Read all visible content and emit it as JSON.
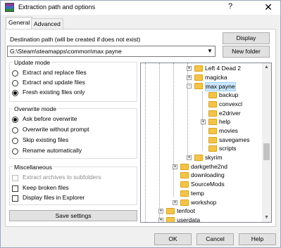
{
  "window": {
    "title": "Extraction path and options",
    "help_glyph": "?",
    "close_glyph": "✕"
  },
  "tabs": [
    "General",
    "Advanced"
  ],
  "destination": {
    "label": "Destination path (will be created if does not exist)",
    "value": "G:\\Steam\\steamapps\\common\\max payne",
    "display_button": "Display",
    "new_folder_button": "New folder"
  },
  "update_mode": {
    "title": "Update mode",
    "options": [
      {
        "label": "Extract and replace files",
        "checked": false
      },
      {
        "label": "Extract and update files",
        "checked": false
      },
      {
        "label": "Fresh existing files only",
        "checked": true
      }
    ]
  },
  "overwrite_mode": {
    "title": "Overwrite mode",
    "options": [
      {
        "label": "Ask before overwrite",
        "checked": true
      },
      {
        "label": "Overwrite without prompt",
        "checked": false
      },
      {
        "label": "Skip existing files",
        "checked": false
      },
      {
        "label": "Rename automatically",
        "checked": false
      }
    ]
  },
  "miscellaneous": {
    "title": "Miscellaneous",
    "options": [
      {
        "label": "Extract archives to subfolders",
        "checked": false,
        "disabled": true
      },
      {
        "label": "Keep broken files",
        "checked": false,
        "disabled": false
      },
      {
        "label": "Display files in Explorer",
        "checked": false,
        "disabled": false
      }
    ]
  },
  "save_settings_button": "Save settings",
  "tree": [
    {
      "label": "Left 4 Dead 2",
      "level": 2,
      "expander": "+"
    },
    {
      "label": "magicka",
      "level": 2,
      "expander": "+"
    },
    {
      "label": "max payne",
      "level": 2,
      "expander": "-",
      "selected": true
    },
    {
      "label": "backup",
      "level": 3,
      "expander": ""
    },
    {
      "label": "convexcl",
      "level": 3,
      "expander": ""
    },
    {
      "label": "e2driver",
      "level": 3,
      "expander": ""
    },
    {
      "label": "help",
      "level": 3,
      "expander": "+"
    },
    {
      "label": "movies",
      "level": 3,
      "expander": ""
    },
    {
      "label": "savegames",
      "level": 3,
      "expander": ""
    },
    {
      "label": "scripts",
      "level": 3,
      "expander": ""
    },
    {
      "label": "skyrim",
      "level": 2,
      "expander": "+"
    },
    {
      "label": "darkgethe2nd",
      "level": 1,
      "expander": "+"
    },
    {
      "label": "downloading",
      "level": 1,
      "expander": ""
    },
    {
      "label": "SourceMods",
      "level": 1,
      "expander": ""
    },
    {
      "label": "temp",
      "level": 1,
      "expander": ""
    },
    {
      "label": "workshop",
      "level": 1,
      "expander": "+"
    },
    {
      "label": "tenfoot",
      "level": 0,
      "expander": "+"
    },
    {
      "label": "userdata",
      "level": 0,
      "expander": "+"
    }
  ],
  "footer": {
    "ok": "OK",
    "cancel": "Cancel",
    "help": "Help"
  }
}
